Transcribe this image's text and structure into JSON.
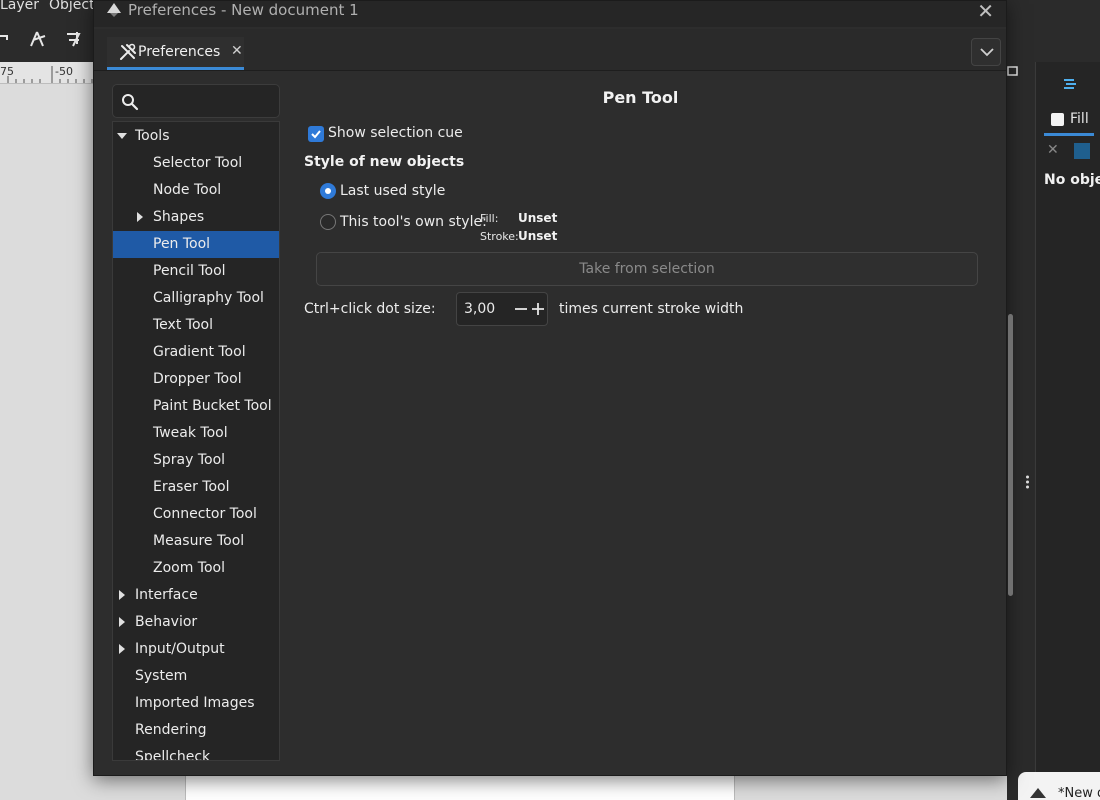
{
  "background": {
    "menu": [
      "Layer",
      "Object"
    ],
    "ruler_labels": [
      "75",
      "-50"
    ],
    "right_panel": {
      "fill_tab": "Fill",
      "status": "No obje"
    },
    "taskbar_item": "*New d"
  },
  "dialog": {
    "title": "Preferences - New document 1",
    "tab_label": "Preferences",
    "search": {
      "placeholder": "",
      "value": ""
    },
    "tree": [
      {
        "label": "Tools",
        "level": 0,
        "expander": "expanded"
      },
      {
        "label": "Selector Tool",
        "level": 1
      },
      {
        "label": "Node Tool",
        "level": 1
      },
      {
        "label": "Shapes",
        "level": 1,
        "expander": "collapsed"
      },
      {
        "label": "Pen Tool",
        "level": 1,
        "selected": true
      },
      {
        "label": "Pencil Tool",
        "level": 1
      },
      {
        "label": "Calligraphy Tool",
        "level": 1
      },
      {
        "label": "Text Tool",
        "level": 1
      },
      {
        "label": "Gradient Tool",
        "level": 1
      },
      {
        "label": "Dropper Tool",
        "level": 1
      },
      {
        "label": "Paint Bucket Tool",
        "level": 1
      },
      {
        "label": "Tweak Tool",
        "level": 1
      },
      {
        "label": "Spray Tool",
        "level": 1
      },
      {
        "label": "Eraser Tool",
        "level": 1
      },
      {
        "label": "Connector Tool",
        "level": 1
      },
      {
        "label": "Measure Tool",
        "level": 1
      },
      {
        "label": "Zoom Tool",
        "level": 1
      },
      {
        "label": "Interface",
        "level": 0,
        "expander": "collapsed"
      },
      {
        "label": "Behavior",
        "level": 0,
        "expander": "collapsed"
      },
      {
        "label": "Input/Output",
        "level": 0,
        "expander": "collapsed"
      },
      {
        "label": "System",
        "level": 0
      },
      {
        "label": "Imported Images",
        "level": 0
      },
      {
        "label": "Rendering",
        "level": 0
      },
      {
        "label": "Spellcheck",
        "level": 0
      }
    ],
    "content": {
      "title": "Pen Tool",
      "show_selection_cue": {
        "label": "Show selection cue",
        "checked": true
      },
      "style_section": "Style of new objects",
      "radio_last": {
        "label": "Last used style",
        "selected": true
      },
      "radio_own": {
        "label": "This tool's own style:",
        "selected": false
      },
      "fill_label": "Fill:",
      "fill_value": "Unset",
      "stroke_label": "Stroke:",
      "stroke_value": "Unset",
      "take_button": "Take from selection",
      "dot_size_label": "Ctrl+click dot size:",
      "dot_size_value": "3,00",
      "dot_size_suffix": "times current stroke width"
    }
  },
  "colors": {
    "accent": "#2f7ad8",
    "selection": "#1f5aa6",
    "dialog_bg": "#2d2d2d"
  }
}
